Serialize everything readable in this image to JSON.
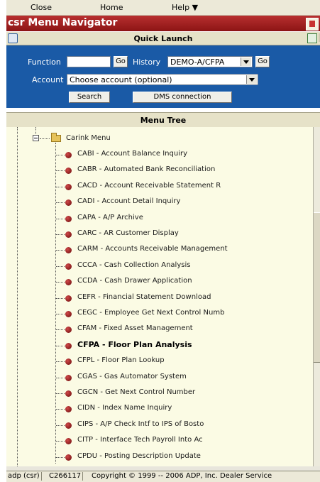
{
  "menubar": {
    "close": "Close",
    "home": "Home",
    "help": "Help ▼"
  },
  "window": {
    "title": "csr Menu Navigator"
  },
  "quick_launch": {
    "title": "Quick Launch",
    "function_label": "Function",
    "function_value": "",
    "go1": "Go",
    "history_label": "History",
    "history_value": "DEMO-A/CFPA",
    "go2": "Go",
    "account_label": "Account",
    "account_value": "Choose account (optional)",
    "search_button": "Search",
    "dms_button": "DMS connection"
  },
  "menu_tree": {
    "title": "Menu Tree",
    "root_label": "Carink Menu",
    "items": [
      {
        "label": "CABI - Account Balance Inquiry",
        "bold": false
      },
      {
        "label": "CABR - Automated Bank Reconciliation",
        "bold": false
      },
      {
        "label": "CACD - Account Receivable Statement R",
        "bold": false
      },
      {
        "label": "CADI - Account Detail Inquiry",
        "bold": false
      },
      {
        "label": "CAPA - A/P Archive",
        "bold": false
      },
      {
        "label": "CARC - AR Customer Display",
        "bold": false
      },
      {
        "label": "CARM - Accounts Receivable Management",
        "bold": false
      },
      {
        "label": "CCCA - Cash Collection Analysis",
        "bold": false
      },
      {
        "label": "CCDA - Cash Drawer Application",
        "bold": false
      },
      {
        "label": "CEFR - Financial Statement Download",
        "bold": false
      },
      {
        "label": "CEGC - Employee Get Next Control Numb",
        "bold": false
      },
      {
        "label": "CFAM - Fixed Asset Management",
        "bold": false
      },
      {
        "label": "CFPA - Floor Plan Analysis",
        "bold": true
      },
      {
        "label": "CFPL - Floor Plan Lookup",
        "bold": false
      },
      {
        "label": "CGAS - Gas Automator System",
        "bold": false
      },
      {
        "label": "CGCN - Get Next Control Number",
        "bold": false
      },
      {
        "label": "CIDN - Index Name Inquiry",
        "bold": false
      },
      {
        "label": "CIPS - A/P Check Intf to IPS of Bosto",
        "bold": false
      },
      {
        "label": "CITP - Interface Tech Payroll Into Ac",
        "bold": false
      },
      {
        "label": "CPDU - Posting Description Update",
        "bold": false
      }
    ]
  },
  "status_bar": {
    "cell1": "adp (csr)",
    "cell2": "C266117",
    "cell3": "Copyright © 1999 -- 2006 ADP, Inc. Dealer Service"
  }
}
